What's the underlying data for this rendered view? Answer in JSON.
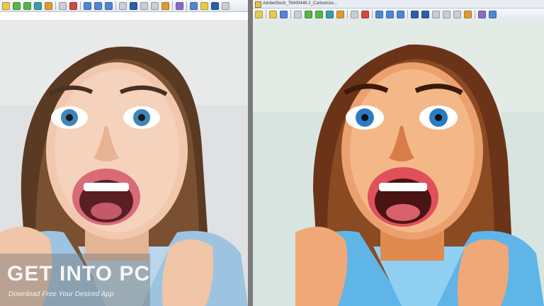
{
  "right_window": {
    "title": "AdobeStock_76400449-2_Cartoonize..."
  },
  "toolbar_icons": [
    "open-icon",
    "save-icon",
    "copy-icon",
    "paste-icon",
    "undo-icon",
    "redo-icon",
    "zoom-in-icon",
    "zoom-out-icon",
    "prev-icon",
    "next-icon",
    "crop-icon",
    "fit-icon",
    "settings-icon",
    "print-icon"
  ],
  "watermark": {
    "title": "GET INTO PC",
    "subtitle": "Download Free Your Desired App"
  },
  "colors": {
    "toolbar_bg": "#e4e9ef",
    "divider": "#7a7a7a",
    "photo_bg_left": "#dfe1e2",
    "photo_bg_right": "#d7e4df"
  }
}
